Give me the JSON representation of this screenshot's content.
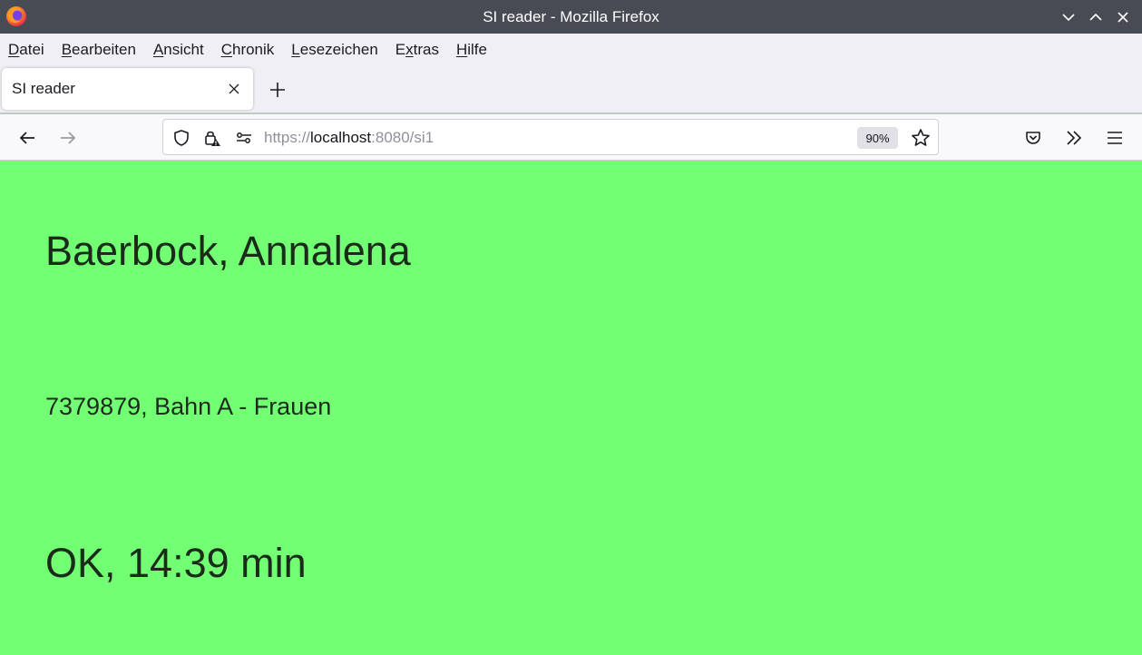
{
  "window": {
    "title": "SI reader - Mozilla Firefox"
  },
  "menu": {
    "items": [
      {
        "mnemonic": "D",
        "rest": "atei"
      },
      {
        "mnemonic": "B",
        "rest": "earbeiten"
      },
      {
        "mnemonic": "A",
        "rest": "nsicht"
      },
      {
        "mnemonic": "C",
        "rest": "hronik"
      },
      {
        "mnemonic": "L",
        "rest": "esezeichen"
      },
      {
        "mnemonic": "E",
        "pre": "",
        "rest": "xtras",
        "split": "E|x"
      },
      {
        "mnemonic": "H",
        "rest": "ilfe"
      }
    ]
  },
  "tabs": [
    {
      "label": "SI reader",
      "active": true
    }
  ],
  "urlbar": {
    "scheme": "https://",
    "host": "localhost",
    "rest": ":8080/si1",
    "zoom": "90%"
  },
  "page": {
    "name": "Baerbock, Annalena",
    "info": "7379879, Bahn A - Frauen",
    "result": "OK, 14:39 min",
    "background_color": "#73ff73"
  },
  "colors": {
    "titlebar": "#474c54",
    "toolbar": "#f0f0f4",
    "navbar": "#f9f9fb"
  },
  "icons": {
    "titlebar": [
      "firefox-logo-icon",
      "chevron-down-icon",
      "chevron-up-icon",
      "close-icon"
    ],
    "navbar": [
      "back-arrow-icon",
      "forward-arrow-icon",
      "shield-icon",
      "lock-warning-icon",
      "permissions-icon",
      "star-icon",
      "pocket-icon",
      "overflow-chevrons-icon",
      "hamburger-menu-icon"
    ]
  }
}
